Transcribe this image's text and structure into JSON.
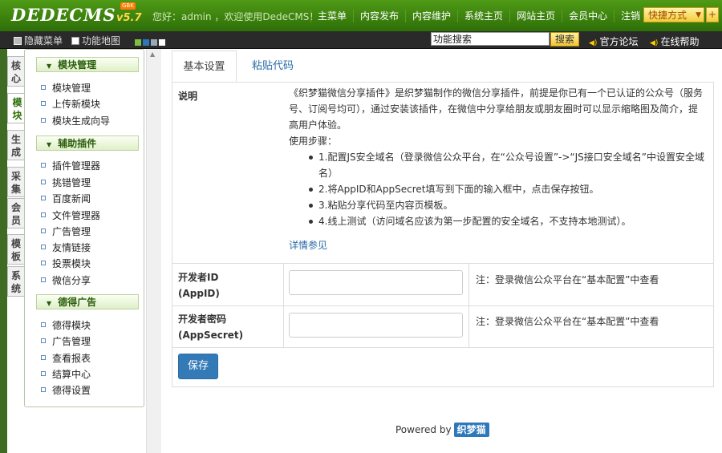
{
  "header": {
    "logo_text": "DEDECMS",
    "logo_version": "v5.7",
    "logo_badge": "GBK",
    "greeting": "您好：admin ，欢迎使用DedeCMS！",
    "nav": [
      "主菜单",
      "内容发布",
      "内容维护",
      "系统主页",
      "网站主页",
      "会员中心",
      "注销"
    ],
    "quick_label": "快捷方式",
    "plus_label": "+"
  },
  "toolbar": {
    "hide_menu": "隐藏菜单",
    "site_map": "功能地图",
    "search_value": "功能搜索",
    "search_button": "搜索",
    "forum_link": "官方论坛",
    "help_link": "在线帮助",
    "swatch_colors": [
      "#7bc043",
      "#2f77bb",
      "#9aa9b8",
      "#ffffff"
    ]
  },
  "vtabs": [
    {
      "label": "核心",
      "active": false
    },
    {
      "label": "模块",
      "active": true
    },
    {
      "label": "生成",
      "active": false
    },
    {
      "label": "采集",
      "active": false
    },
    {
      "label": "会员",
      "active": false
    },
    {
      "label": "模板",
      "active": false
    },
    {
      "label": "系统",
      "active": false
    }
  ],
  "sidebar": {
    "groups": [
      {
        "title": "模块管理",
        "items": [
          "模块管理",
          "上传新模块",
          "模块生成向导"
        ]
      },
      {
        "title": "辅助插件",
        "items": [
          "插件管理器",
          "挑错管理",
          "百度新闻",
          "文件管理器",
          "广告管理",
          "友情链接",
          "投票模块",
          "微信分享"
        ]
      },
      {
        "title": "德得广告",
        "items": [
          "德得模块",
          "广告管理",
          "查看报表",
          "结算中心",
          "德得设置"
        ]
      }
    ]
  },
  "main": {
    "tabs": [
      "基本设置",
      "粘贴代码"
    ],
    "desc_label": "说明",
    "desc_text": "《织梦猫微信分享插件》是织梦猫制作的微信分享插件，前提是你已有一个已认证的公众号（服务号、订阅号均可），通过安装该插件，在微信中分享给朋友或朋友圈时可以显示缩略图及简介，提高用户体验。",
    "steps_title": "使用步骤：",
    "steps": [
      "1.配置JS安全域名（登录微信公众平台，在“公众号设置”->“JS接口安全域名”中设置安全域名）",
      "2.将AppID和AppSecret填写到下面的输入框中，点击保存按钮。",
      "3.粘贴分享代码至内容页模板。",
      "4.线上测试（访问域名应该为第一步配置的安全域名，不支持本地测试）。"
    ],
    "more_link": "详情参见",
    "appid_label_1": "开发者ID",
    "appid_label_2": "(AppID)",
    "appid_value": "",
    "appid_note": "注：登录微信公众平台在“基本配置”中查看",
    "secret_label_1": "开发者密码",
    "secret_label_2": "(AppSecret)",
    "secret_value": "",
    "secret_note": "注：登录微信公众平台在“基本配置”中查看",
    "save_button": "保存"
  },
  "footer": {
    "powered_by": "Powered by",
    "brand": "织梦猫"
  }
}
